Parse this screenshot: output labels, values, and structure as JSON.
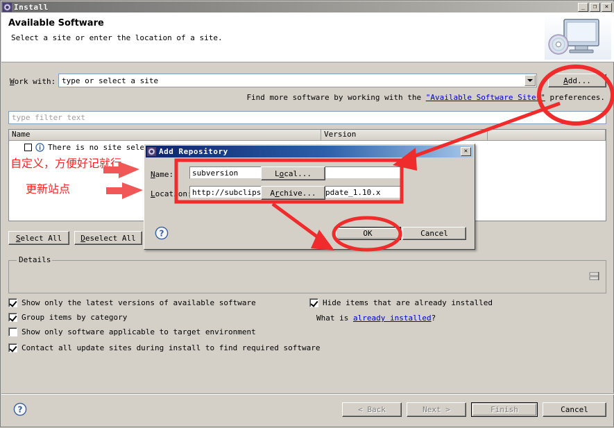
{
  "window": {
    "title": "Install",
    "icon": "install-gear-icon",
    "minimize": "_",
    "maximize": "❐",
    "close": "✕"
  },
  "header": {
    "title": "Available Software",
    "subtitle": "Select a site or enter the location of a site.",
    "banner_icon": "monitor-cd-icon"
  },
  "workwith": {
    "label_prefix": "W",
    "label_rest": "ork with:",
    "combo_value": "type or select a site",
    "dropdown_icon": "chevron-down-icon",
    "add_button": "Add..."
  },
  "findmore": {
    "prefix": "Find more software by working with the ",
    "link": "\"Available Software Sites\"",
    "suffix": " preferences."
  },
  "filter": {
    "placeholder": "type filter text"
  },
  "table": {
    "columns": [
      "Name",
      "Version",
      ""
    ],
    "rows": [
      {
        "checked": false,
        "icon": "info-icon",
        "name": "There is no site selec"
      }
    ]
  },
  "annotations": {
    "note1": "自定义，方便好记就行",
    "note2": "更新站点",
    "color": "#ff2020"
  },
  "list_buttons": {
    "select_all": "Select All",
    "deselect_all": "Deselect All"
  },
  "details": {
    "legend": "Details",
    "content": "",
    "sash_icon": "resize-sash-icon"
  },
  "options": {
    "left": [
      {
        "label": "Show only the latest versions of available software",
        "checked": true
      },
      {
        "label": "Group items by category",
        "checked": true
      },
      {
        "label": "Show only software applicable to target environment",
        "checked": false
      },
      {
        "label": "Contact all update sites during install to find required software",
        "checked": true
      }
    ],
    "right": [
      {
        "label": "Hide items that are already installed",
        "checked": true
      }
    ],
    "whatis_prefix": "What is ",
    "whatis_link": "already installed",
    "whatis_suffix": "?"
  },
  "footer": {
    "help_icon": "help-question-icon",
    "back": "< Back",
    "next": "Next >",
    "finish": "Finish",
    "cancel": "Cancel"
  },
  "dialog": {
    "title": "Add Repository",
    "icon": "install-gear-icon",
    "close": "✕",
    "name_label": "Name:",
    "name_value": "subversion",
    "location_label": "Location:",
    "location_value": "http://subclipse.tigris.org/update_1.10.x",
    "local_button": "Local...",
    "archive_button": "Archive...",
    "help_icon": "help-question-icon",
    "ok_button": "OK",
    "cancel_button": "Cancel"
  }
}
